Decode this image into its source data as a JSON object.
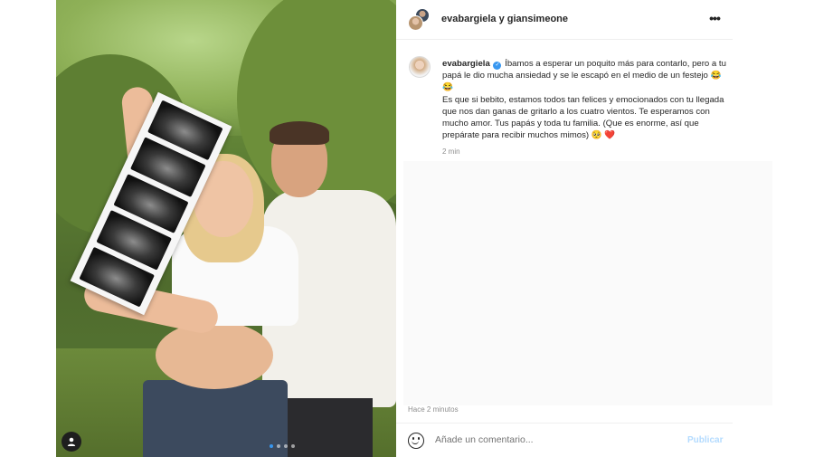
{
  "post": {
    "header": {
      "title": "evabargiela y giansimeone",
      "more_icon": "more-horizontal-icon"
    },
    "caption": {
      "username": "evabargiela",
      "verified_icon": "verified-badge-icon",
      "line1": " Íbamos a esperar un poquito más para contarlo, pero a tu papá le dio mucha ansiedad y se le escapó en el medio de un festejo 😂 😂",
      "line2": "Es que si bebito, estamos todos tan felices y emocionados con tu llegada que nos dan ganas de gritarlo a los cuatro vientos. Te esperamos con mucho amor. Tus papás y toda tu familia. (Que es enorme, así que prepárate para recibir muchos mimos) 🥺 ❤️",
      "time": "2 min"
    },
    "timestamp": "Hace 2 minutos",
    "comment_box": {
      "placeholder": "Añade un comentario...",
      "publish_label": "Publicar",
      "emoji_icon": "smiley-icon"
    },
    "media": {
      "carousel_count": 4,
      "carousel_active_index": 0,
      "tagged_user_icon": "user-tag-icon",
      "next_icon": "chevron-right-icon"
    }
  },
  "colors": {
    "accent": "#3897f0",
    "publish_disabled": "#b3dbff",
    "muted_text": "#8e8e8e",
    "divider": "#efefef"
  }
}
